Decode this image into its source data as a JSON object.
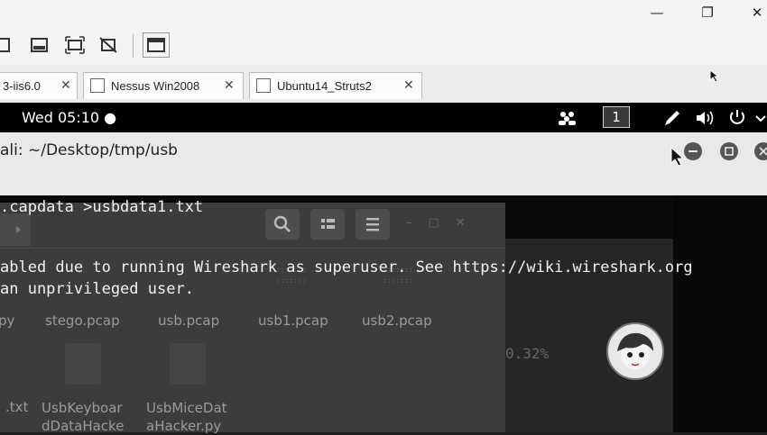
{
  "host": {
    "window_controls": {
      "minimize": "—",
      "restore": "❐",
      "close": "✕"
    }
  },
  "tabs": [
    {
      "label": "3-iis6.0",
      "close": "✕"
    },
    {
      "label": "Nessus Win2008",
      "close": "✕"
    },
    {
      "label": "Ubuntu14_Struts2",
      "close": "✕"
    }
  ],
  "topbar": {
    "clock": "Wed 05:10 ●",
    "workspace": "1"
  },
  "terminal": {
    "title": "ali: ~/Desktop/tmp/usb",
    "lines": [
      ".capdata >usbdata1.txt",
      "abled due to running Wireshark as superuser. See https://wiki.wireshark.org",
      "an unprivileged user."
    ]
  },
  "file_manager_ghost": {
    "files_row1": [
      "py",
      "stego.pcap",
      "usb.pcap",
      "usb1.pcap",
      "usb2.pcap"
    ],
    "files_row2": [
      ".txt",
      "UsbKeyboar\ndDataHacke",
      "UsbMiceDat\naHacker.py"
    ],
    "percent": "0.32%"
  },
  "colors": {
    "accent": "#000000",
    "terminal_bg": "#0b0b0b"
  }
}
